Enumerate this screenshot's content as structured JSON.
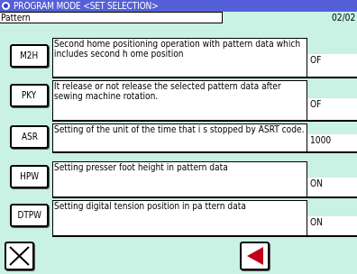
{
  "header": {
    "title": "PROGRAM MODE <SET SELECTION>",
    "pattern_label": "Pattern",
    "page": "02/02"
  },
  "rows": [
    {
      "code": "M2H",
      "description": "Second home positioning operation with pattern data which includes second h ome position",
      "value": "OF"
    },
    {
      "code": "PKY",
      "description": "It release or not release the selected pattern data after sewing machine rotation.",
      "value": "OF"
    },
    {
      "code": "ASR",
      "description": "Setting of the unit of the time that i s stopped by ASRT code.",
      "value": "1000"
    },
    {
      "code": "HPW",
      "description": "Setting presser foot height in pattern data",
      "value": "ON"
    },
    {
      "code": "DTPW",
      "description": "Setting digital tension position in pa ttern data",
      "value": "ON"
    }
  ],
  "footer": {
    "close_icon": "close-x-icon",
    "back_icon": "triangle-left-icon",
    "accent_color": "#c00018",
    "title_bar_color": "#5560d8",
    "background_color": "#c9f1e4"
  }
}
